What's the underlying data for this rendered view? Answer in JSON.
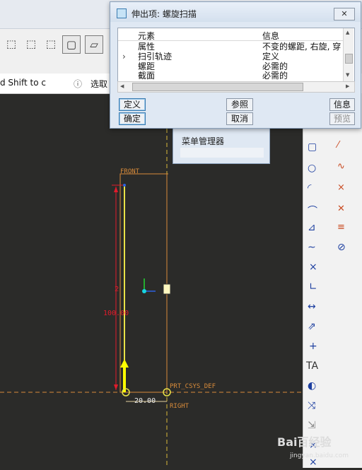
{
  "toolbar": {
    "status_text": "d Shift to c",
    "select_label": "选取"
  },
  "dialog": {
    "title": "伸出项: 螺旋扫描",
    "close_label": "✕",
    "columns": [
      "元素",
      "信息"
    ],
    "rows": [
      {
        "element": "属性",
        "info": "不变的螺距, 右旋, 穿"
      },
      {
        "element": "扫引轨迹",
        "info": "定义"
      },
      {
        "element": "螺距",
        "info": "必需的"
      },
      {
        "element": "截面",
        "info": "必需的"
      }
    ],
    "buttons": {
      "define": "定义",
      "refer": "参照",
      "info": "信息",
      "ok": "确定",
      "cancel": "取消",
      "preview": "预览"
    }
  },
  "menu_manager": {
    "title": "菜单管理器"
  },
  "canvas": {
    "front_label": "FRONT",
    "right_label": "RIGHT",
    "csys_label": "PRT_CSYS_DEF",
    "dim_vertical": "100.00",
    "dim_horizontal": "20.00",
    "marker": "2"
  },
  "watermark": {
    "brand": "Bai百经验",
    "url": "jingyan.baidu.com"
  },
  "icons": [
    "box-icon",
    "cube-icon",
    "rectangle-icon",
    "circle-icon",
    "arc-icon",
    "spline-icon",
    "point-icon",
    "line-icon",
    "dimension-icon",
    "text-icon",
    "palette-icon",
    "close-icon"
  ]
}
